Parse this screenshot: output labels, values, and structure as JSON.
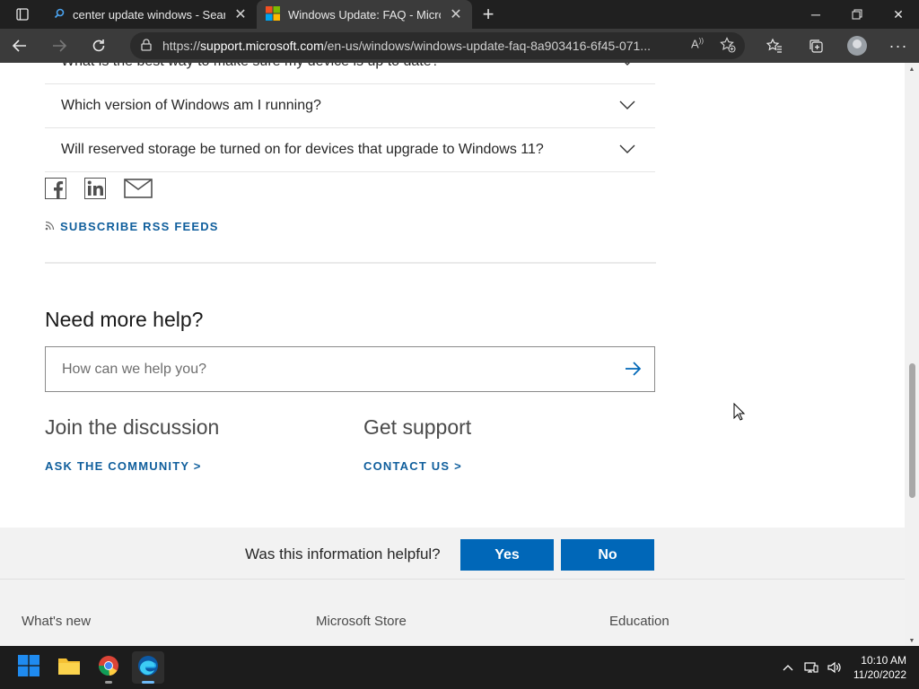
{
  "browser": {
    "tabs": [
      {
        "title": "center update windows - Search",
        "active": false,
        "icon": "search-icon"
      },
      {
        "title": "Windows Update: FAQ - Microsof",
        "active": true,
        "icon": "microsoft-logo-icon"
      }
    ],
    "address": {
      "prefix": "https://",
      "host": "support.microsoft.com",
      "path": "/en-us/windows/windows-update-faq-8a903416-6f45-071..."
    }
  },
  "page": {
    "faq": [
      "What is the best way to make sure my device is up to date?",
      "Which version of Windows am I running?",
      "Will reserved storage be turned on for devices that upgrade to Windows 11?"
    ],
    "rss_label": "SUBSCRIBE RSS FEEDS",
    "help_title": "Need more help?",
    "search_placeholder": "How can we help you?",
    "discussion": {
      "title": "Join the discussion",
      "link": "ASK THE COMMUNITY >"
    },
    "support": {
      "title": "Get support",
      "link": "CONTACT US >"
    },
    "feedback": {
      "question": "Was this information helpful?",
      "yes": "Yes",
      "no": "No"
    },
    "footer_headings": [
      "What's new",
      "Microsoft Store",
      "Education"
    ]
  },
  "taskbar": {
    "time": "10:10 AM",
    "date": "11/20/2022"
  },
  "colors": {
    "link": "#0f5e9c",
    "button": "#0067b8"
  }
}
